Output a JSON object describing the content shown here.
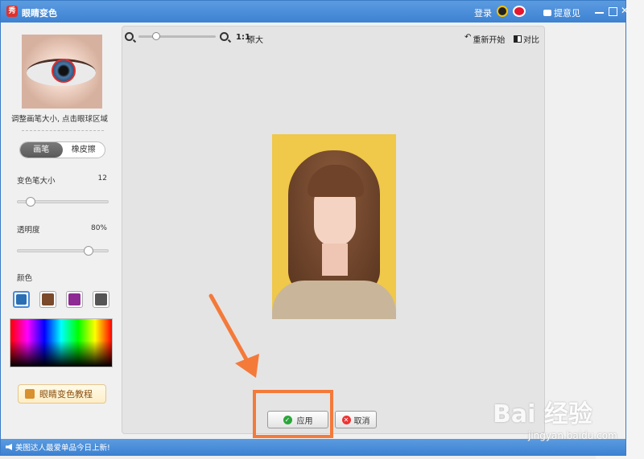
{
  "titlebar": {
    "app_title": "眼睛变色",
    "app_logo_text": "秀",
    "login": "登录",
    "feedback": "提意见"
  },
  "left_panel": {
    "hint": "调整画笔大小, 点击眼球区域",
    "toggle": {
      "brush": "画笔",
      "eraser": "橡皮擦",
      "selected": "brush"
    },
    "brush_size_label": "变色笔大小",
    "brush_size_value": "12",
    "brush_size_level": 0.1,
    "opacity_label": "透明度",
    "opacity_value": "80%",
    "opacity_level": 0.8,
    "color_label": "颜色",
    "swatches": [
      {
        "name": "blue",
        "color": "#2a6fb3",
        "selected": true
      },
      {
        "name": "brown",
        "color": "#7a4a2a",
        "selected": false
      },
      {
        "name": "purple",
        "color": "#8d2a93",
        "selected": false
      },
      {
        "name": "gray",
        "color": "#555555",
        "selected": false
      }
    ],
    "tutorial": "眼睛变色教程"
  },
  "canvas": {
    "ratio": "1:1",
    "original": "原大",
    "restart": "重新开始",
    "compare": "对比",
    "apply": "应用",
    "cancel": "取消"
  },
  "statusbar": {
    "message": "美图达人最爱单品今日上新!"
  },
  "watermark": {
    "brand": "Bai 经验",
    "url": "jingyan.baidu.com"
  },
  "colors": {
    "titlebar": "#4a8bd6",
    "annotation": "#f47a3a"
  }
}
